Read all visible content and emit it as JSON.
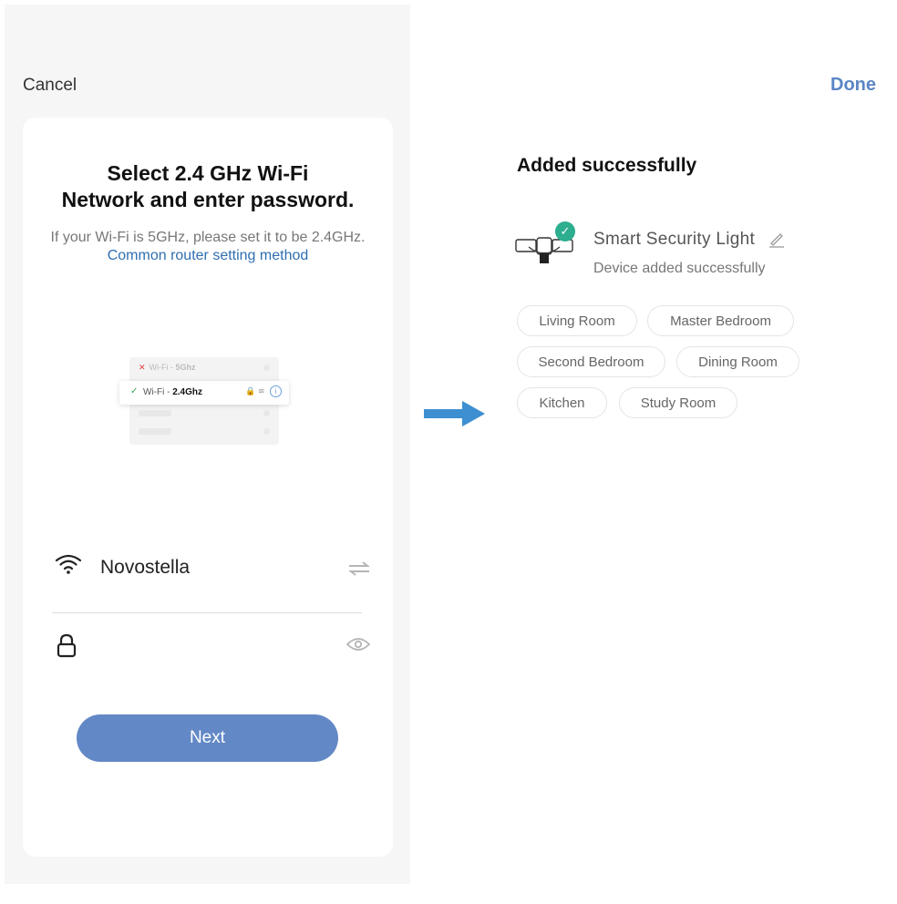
{
  "setup_screen": {
    "cancel_label": "Cancel",
    "title": "Select 2.4 GHz Wi-Fi\nNetwork and enter password.",
    "subtitle_text": "If your Wi-Fi is 5GHz, please set it to be 2.4GHz. ",
    "subtitle_link": "Common router setting method",
    "illustration": {
      "wifi_5g_prefix": "Wi-Fi - ",
      "wifi_5g_band": "5Ghz",
      "wifi_24g_prefix": "Wi-Fi - ",
      "wifi_24g_band": "2.4Ghz"
    },
    "ssid_value": "Novostella",
    "password_value": "",
    "next_label": "Next",
    "accent_color": "#6388c6",
    "link_color": "#2f6eb0"
  },
  "success_screen": {
    "done_label": "Done",
    "title": "Added successfully",
    "device_name": "Smart  Security Light",
    "device_status": "Device added successfully",
    "rooms": [
      "Living Room",
      "Master Bedroom",
      "Second Bedroom",
      "Dining Room",
      "Kitchen",
      "Study Room"
    ],
    "badge_color": "#2cae8f",
    "done_color": "#5b86c4"
  }
}
